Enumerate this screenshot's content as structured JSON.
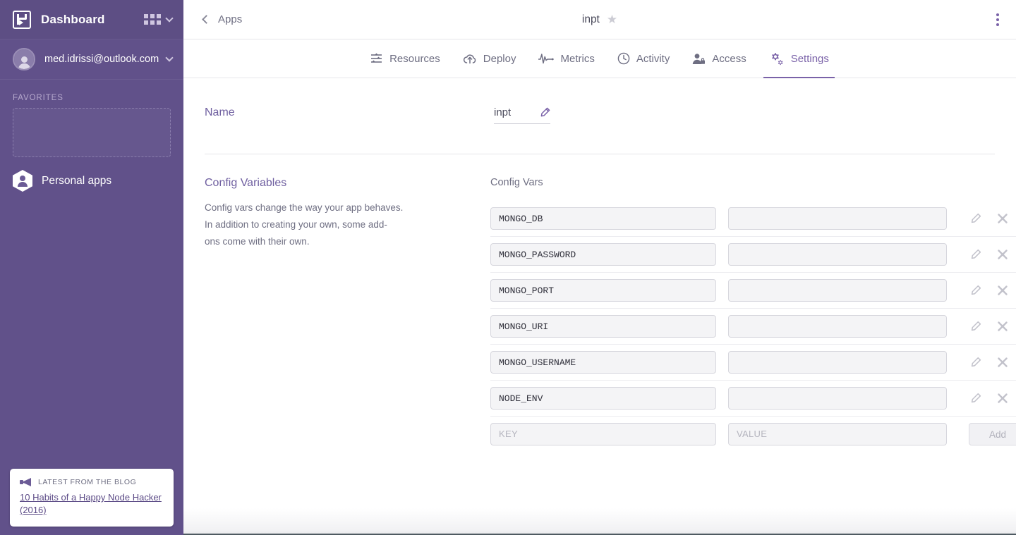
{
  "sidebar": {
    "brand": "Dashboard",
    "brand_logo_icon": "heroku-logo-icon",
    "apps_grid_icon": "apps-grid-icon",
    "account_email": "med.idrissi@outlook.com",
    "favorites_label": "FAVORITES",
    "items": [
      {
        "label": "Personal apps",
        "icon": "person-hexagon-icon"
      }
    ],
    "blog": {
      "kicker": "LATEST FROM THE BLOG",
      "icon": "megaphone-icon",
      "link_text": "10 Habits of a Happy Node Hacker (2016)"
    },
    "colors": {
      "background": "#61518a",
      "header_background": "#5d4e84",
      "favorites_label": "#b6a9cd"
    }
  },
  "topbar": {
    "back_label": "Apps",
    "back_icon": "chevron-left-icon",
    "app_name": "inpt",
    "favorite_icon": "star-icon",
    "menu_icon": "kebab-menu-icon"
  },
  "tabs": [
    {
      "label": "Resources",
      "icon": "sliders-icon",
      "active": false
    },
    {
      "label": "Deploy",
      "icon": "cloud-upload-icon",
      "active": false
    },
    {
      "label": "Metrics",
      "icon": "pulse-icon",
      "active": false
    },
    {
      "label": "Activity",
      "icon": "clock-icon",
      "active": false
    },
    {
      "label": "Access",
      "icon": "person-lock-icon",
      "active": false
    },
    {
      "label": "Settings",
      "icon": "gears-icon",
      "active": true
    }
  ],
  "name_section": {
    "title": "Name",
    "value": "inpt",
    "edit_icon": "pencil-icon"
  },
  "config_section": {
    "title": "Config Variables",
    "description_lines": [
      "Config vars change the way your app behaves.",
      "In addition to creating your own, some add-",
      "ons come with their own."
    ],
    "description": "Config vars change the way your app behaves. In addition to creating your own, some add-ons come with their own.",
    "heading": "Config Vars",
    "vars": [
      {
        "key": "MONGO_DB",
        "value": ""
      },
      {
        "key": "MONGO_PASSWORD",
        "value": ""
      },
      {
        "key": "MONGO_PORT",
        "value": ""
      },
      {
        "key": "MONGO_URI",
        "value": ""
      },
      {
        "key": "MONGO_USERNAME",
        "value": ""
      },
      {
        "key": "NODE_ENV",
        "value": ""
      }
    ],
    "new_row": {
      "key_placeholder": "KEY",
      "value_placeholder": "VALUE",
      "key_value": "",
      "value_value": "",
      "add_label": "Add"
    },
    "row_edit_icon": "pencil-icon",
    "row_delete_icon": "close-x-icon"
  },
  "colors": {
    "accent_purple": "#7a62a8",
    "heading_purple": "#6f5fa0",
    "text_gray": "#6e6e82",
    "border_gray": "#e6e6ea"
  }
}
